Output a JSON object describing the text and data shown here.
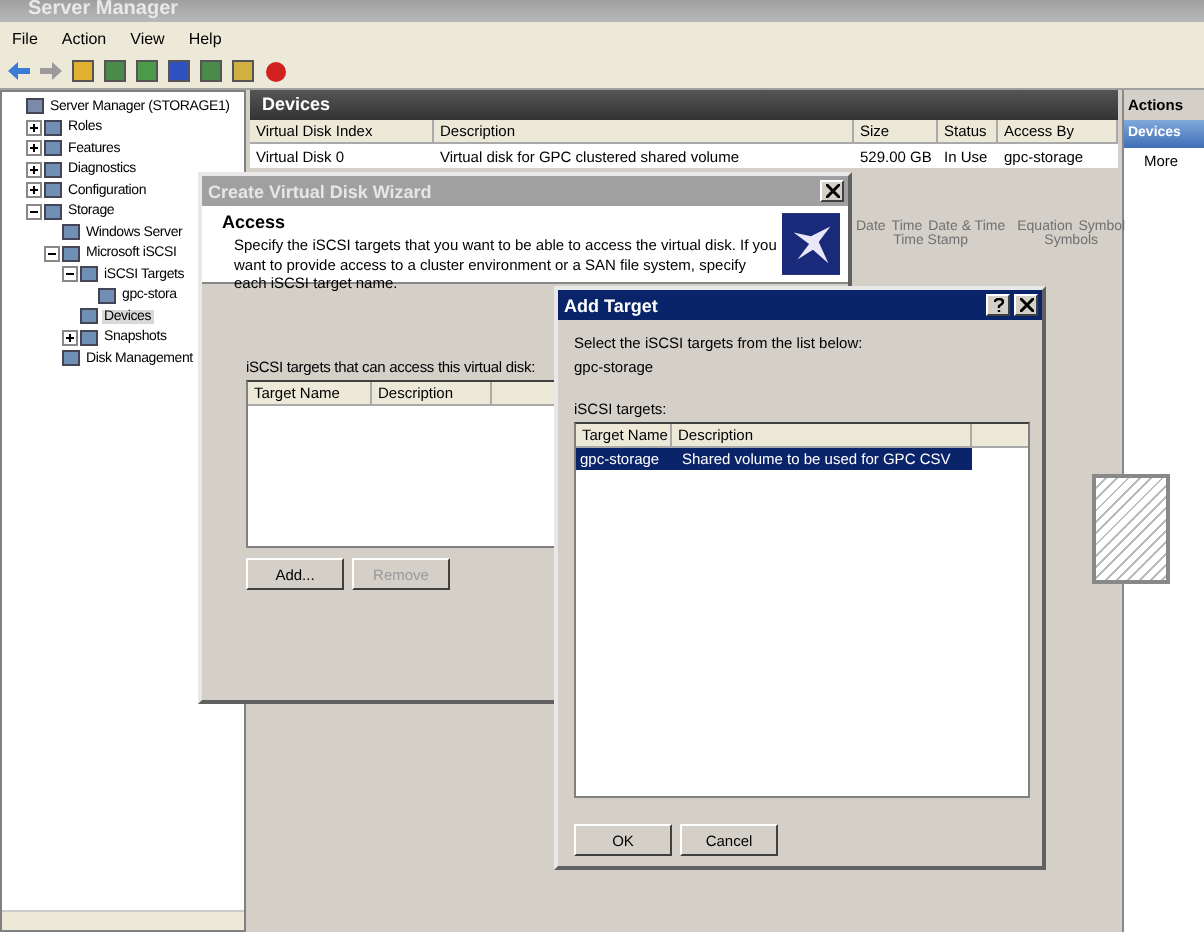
{
  "window": {
    "title": "Server Manager"
  },
  "menu": [
    "File",
    "Action",
    "View",
    "Help"
  ],
  "tree": [
    {
      "label": "Server Manager (STORAGE1)",
      "selected": false,
      "children": [
        {
          "label": "Roles",
          "expanded": false,
          "selected": false
        },
        {
          "label": "Features",
          "expanded": false,
          "selected": false
        },
        {
          "label": "Diagnostics",
          "expanded": false,
          "selected": false
        },
        {
          "label": "Configuration",
          "expanded": false,
          "selected": false
        },
        {
          "label": "Storage",
          "expanded": true,
          "selected": false,
          "children": [
            {
              "label": "Windows Server",
              "selected": false
            },
            {
              "label": "Microsoft iSCSI",
              "expanded": true,
              "selected": false,
              "children": [
                {
                  "label": "iSCSI Targets",
                  "expanded": true,
                  "selected": false,
                  "children": [
                    {
                      "label": "gpc-stora",
                      "selected": false
                    }
                  ]
                },
                {
                  "label": "Devices",
                  "selected": true
                },
                {
                  "label": "Snapshots",
                  "expanded": false,
                  "selected": false
                }
              ]
            },
            {
              "label": "Disk Management",
              "selected": false
            }
          ]
        }
      ]
    }
  ],
  "devices": {
    "title": "Devices",
    "columns": [
      "Virtual Disk Index",
      "Description",
      "Size",
      "Status",
      "Access By"
    ],
    "rows": [
      [
        "Virtual Disk 0",
        "Virtual disk for GPC clustered shared volume",
        "529.00 GB",
        "In Use",
        "gpc-storage"
      ]
    ]
  },
  "actions": {
    "title": "Actions",
    "section": "Devices",
    "items": [
      "More"
    ]
  },
  "ribbon": {
    "groups": [
      {
        "label": "Time Stamp",
        "items": [
          "Date",
          "Time",
          "Date & Time"
        ]
      },
      {
        "label": "Symbols",
        "items": [
          "Equation",
          "Symbol"
        ]
      }
    ]
  },
  "wizard": {
    "title": "Create Virtual Disk Wizard",
    "heading": "Access",
    "description": "Specify the iSCSI targets that you want to be able to access the virtual disk. If you want to provide access to a cluster environment or a SAN file system, specify each iSCSI target name.",
    "list_label": "iSCSI targets that can access this virtual disk:",
    "columns": [
      "Target Name",
      "Description"
    ],
    "buttons": [
      {
        "label": "Add...",
        "disabled": false
      },
      {
        "label": "Remove",
        "disabled": true
      }
    ]
  },
  "add_target": {
    "title": "Add Target",
    "instruction": "Select the iSCSI targets from the list below:",
    "target": "gpc-storage",
    "list_label": "iSCSI targets:",
    "columns": [
      "Target Name",
      "Description"
    ],
    "rows": [
      {
        "cells": [
          "gpc-storage",
          "Shared volume to be used for GPC CSV"
        ],
        "selected": true
      }
    ],
    "buttons": [
      "OK",
      "Cancel"
    ]
  }
}
